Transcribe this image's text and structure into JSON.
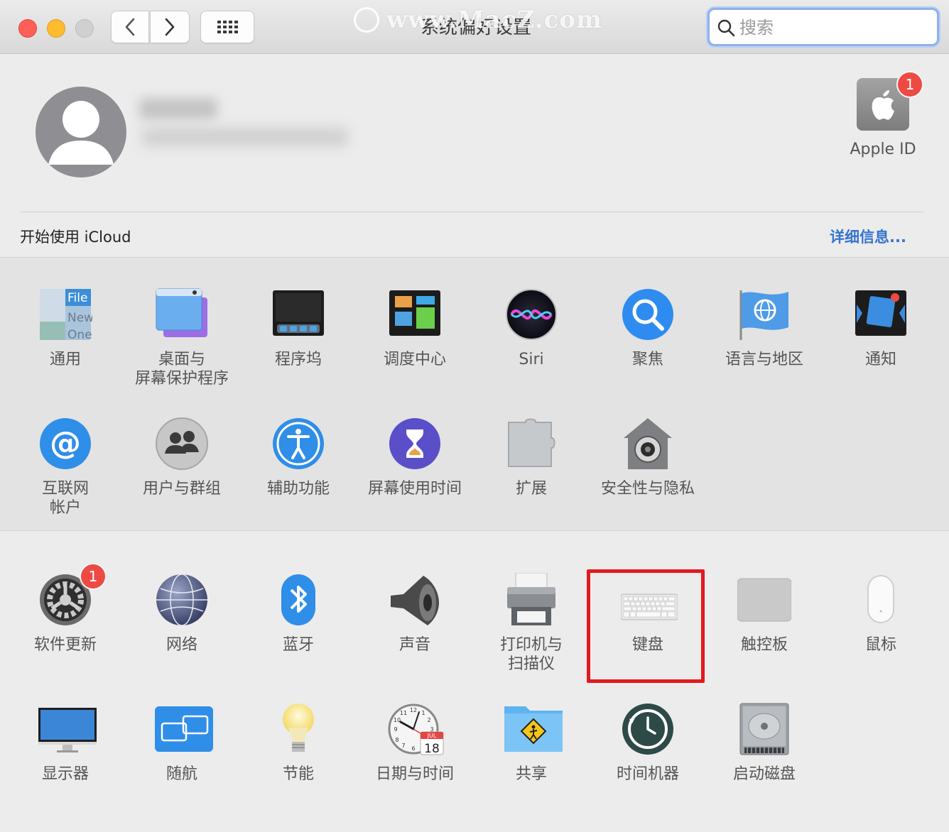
{
  "window": {
    "title": "系统偏好设置",
    "watermark": "www.MacZ.com"
  },
  "toolbar": {
    "back_icon": "chevron-left-icon",
    "forward_icon": "chevron-right-icon",
    "grid_icon": "grid-icon"
  },
  "search": {
    "placeholder": "搜索",
    "value": ""
  },
  "account": {
    "apple_id_label": "Apple ID",
    "apple_id_badge": "1"
  },
  "icloud": {
    "label": "开始使用 iCloud",
    "details_link": "详细信息..."
  },
  "section1": [
    {
      "label": "通用",
      "icon": "general-icon"
    },
    {
      "label": "桌面与\n屏幕保护程序",
      "icon": "desktop-screensaver-icon"
    },
    {
      "label": "程序坞",
      "icon": "dock-icon"
    },
    {
      "label": "调度中心",
      "icon": "mission-control-icon"
    },
    {
      "label": "Siri",
      "icon": "siri-icon"
    },
    {
      "label": "聚焦",
      "icon": "spotlight-icon"
    },
    {
      "label": "语言与地区",
      "icon": "language-region-icon"
    },
    {
      "label": "通知",
      "icon": "notifications-icon"
    },
    {
      "label": "互联网\n帐户",
      "icon": "internet-accounts-icon"
    },
    {
      "label": "用户与群组",
      "icon": "users-groups-icon"
    },
    {
      "label": "辅助功能",
      "icon": "accessibility-icon"
    },
    {
      "label": "屏幕使用时间",
      "icon": "screen-time-icon"
    },
    {
      "label": "扩展",
      "icon": "extensions-icon"
    },
    {
      "label": "安全性与隐私",
      "icon": "security-privacy-icon"
    }
  ],
  "section2": [
    {
      "label": "软件更新",
      "icon": "software-update-icon",
      "badge": "1"
    },
    {
      "label": "网络",
      "icon": "network-icon"
    },
    {
      "label": "蓝牙",
      "icon": "bluetooth-icon"
    },
    {
      "label": "声音",
      "icon": "sound-icon"
    },
    {
      "label": "打印机与\n扫描仪",
      "icon": "printer-scanner-icon"
    },
    {
      "label": "键盘",
      "icon": "keyboard-icon"
    },
    {
      "label": "触控板",
      "icon": "trackpad-icon"
    },
    {
      "label": "鼠标",
      "icon": "mouse-icon"
    },
    {
      "label": "显示器",
      "icon": "displays-icon"
    },
    {
      "label": "随航",
      "icon": "sidecar-icon"
    },
    {
      "label": "节能",
      "icon": "energy-saver-icon"
    },
    {
      "label": "日期与时间",
      "icon": "date-time-icon",
      "calendar_month": "JUL",
      "calendar_day": "18"
    },
    {
      "label": "共享",
      "icon": "sharing-icon"
    },
    {
      "label": "时间机器",
      "icon": "time-machine-icon"
    },
    {
      "label": "启动磁盘",
      "icon": "startup-disk-icon"
    }
  ],
  "colors": {
    "accent_link": "#3674cf",
    "highlight_box": "#e21a1f",
    "badge": "#ee4a44"
  }
}
